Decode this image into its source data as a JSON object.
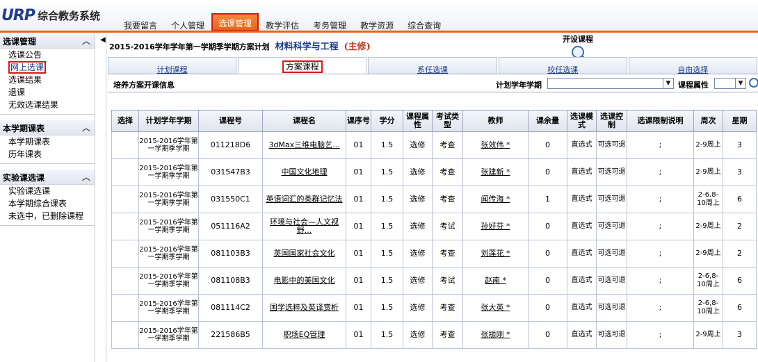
{
  "app": {
    "logo": "URP",
    "title": "综合教务系统"
  },
  "nav": {
    "tabs": [
      {
        "label": "我要留言"
      },
      {
        "label": "个人管理"
      },
      {
        "label": "选课管理",
        "active": true
      },
      {
        "label": "教学评估"
      },
      {
        "label": "考务管理"
      },
      {
        "label": "教学资源"
      },
      {
        "label": "综合查询"
      }
    ]
  },
  "sidebar": {
    "groups": [
      {
        "title": "选课管理",
        "items": [
          "选课公告",
          "网上选课",
          "选课结果",
          "退课",
          "无效选课结果"
        ],
        "selected": 1
      },
      {
        "title": "本学期课表",
        "items": [
          "本学期课表",
          "历年课表"
        ]
      },
      {
        "title": "实验课选课",
        "items": [
          "实验课选课",
          "本学期综合课表",
          "未选中，已删除课程"
        ]
      }
    ]
  },
  "main": {
    "plan_text": "2015-2016学年学年第一学期季学期方案计划",
    "major": "材料科学与工程",
    "subtitle": "(主修)",
    "open_course_label": "开设课程",
    "tabs": [
      "计划课程",
      "方案课程",
      "系任选课",
      "校任选课",
      "自由选择"
    ],
    "active_tab": 1,
    "info_title": "培养方案开课信息",
    "term_label": "计划学年学期",
    "term_value": "",
    "attr_label": "课程属性",
    "attr_value": ""
  },
  "table": {
    "headers": [
      "选择",
      "计划学年学期",
      "课程号",
      "课程名",
      "课序号",
      "学分",
      "课程属性",
      "考试类型",
      "教师",
      "课余量",
      "选课模式",
      "选课控制",
      "选课限制说明",
      "周次",
      "星期"
    ],
    "rows": [
      {
        "term": "2015-2016学年第一学期季学期",
        "code": "011218D6",
        "name": "3dMax三维电脑艺...",
        "seq": "01",
        "credit": "1.5",
        "attr": "选修",
        "exam": "考查",
        "teacher": "张效伟 *",
        "remain": "0",
        "mode": "直选式",
        "ctrl": "可选可退",
        "limit": ";",
        "weeks": "2-9周上",
        "day": "3"
      },
      {
        "term": "2015-2016学年第一学期季学期",
        "code": "031547B3",
        "name": "中国文化地理",
        "seq": "01",
        "credit": "1.5",
        "attr": "选修",
        "exam": "考查",
        "teacher": "张建新 *",
        "remain": "0",
        "mode": "直选式",
        "ctrl": "可选可退",
        "limit": ";",
        "weeks": "2-9周上",
        "day": "3"
      },
      {
        "term": "2015-2016学年第一学期季学期",
        "code": "031550C1",
        "name": "英语词汇的类群记忆法",
        "seq": "01",
        "credit": "1.5",
        "attr": "选修",
        "exam": "考查",
        "teacher": "闻传海 *",
        "remain": "1",
        "mode": "直选式",
        "ctrl": "可选可退",
        "limit": ";",
        "weeks": "2-6,8-10周上",
        "day": "6"
      },
      {
        "term": "2015-2016学年第一学期季学期",
        "code": "051116A2",
        "name": "环境与社会—人文视野...",
        "seq": "01",
        "credit": "1.5",
        "attr": "选修",
        "exam": "考试",
        "teacher": "孙好芬 *",
        "remain": "0",
        "mode": "直选式",
        "ctrl": "可选可退",
        "limit": ";",
        "weeks": "2-9周上",
        "day": "2"
      },
      {
        "term": "2015-2016学年第一学期季学期",
        "code": "081103B3",
        "name": "英国国家社会文化",
        "seq": "01",
        "credit": "1.5",
        "attr": "选修",
        "exam": "考查",
        "teacher": "刘莲花 *",
        "remain": "0",
        "mode": "直选式",
        "ctrl": "可选可退",
        "limit": ";",
        "weeks": "2-9周上",
        "day": "2"
      },
      {
        "term": "2015-2016学年第一学期季学期",
        "code": "081108B3",
        "name": "电影中的美国文化",
        "seq": "01",
        "credit": "1.5",
        "attr": "选修",
        "exam": "考试",
        "teacher": "赵南 *",
        "remain": "0",
        "mode": "直选式",
        "ctrl": "可选可退",
        "limit": ";",
        "weeks": "2-6,8-10周上",
        "day": "6"
      },
      {
        "term": "2015-2016学年第一学期季学期",
        "code": "081114C2",
        "name": "国学选粹及英译赏析",
        "seq": "01",
        "credit": "1.5",
        "attr": "选修",
        "exam": "考查",
        "teacher": "张大英 *",
        "remain": "0",
        "mode": "直选式",
        "ctrl": "可选可退",
        "limit": ";",
        "weeks": "2-6,8-10周上",
        "day": "6"
      },
      {
        "term": "2015-2016学年第一学期季学期",
        "code": "221586B5",
        "name": "职场EQ管理",
        "seq": "01",
        "credit": "1.5",
        "attr": "选修",
        "exam": "考查",
        "teacher": "张振刚 *",
        "remain": "0",
        "mode": "直选式",
        "ctrl": "可选可退",
        "limit": ";",
        "weeks": "2-9周上",
        "day": "3"
      }
    ]
  }
}
